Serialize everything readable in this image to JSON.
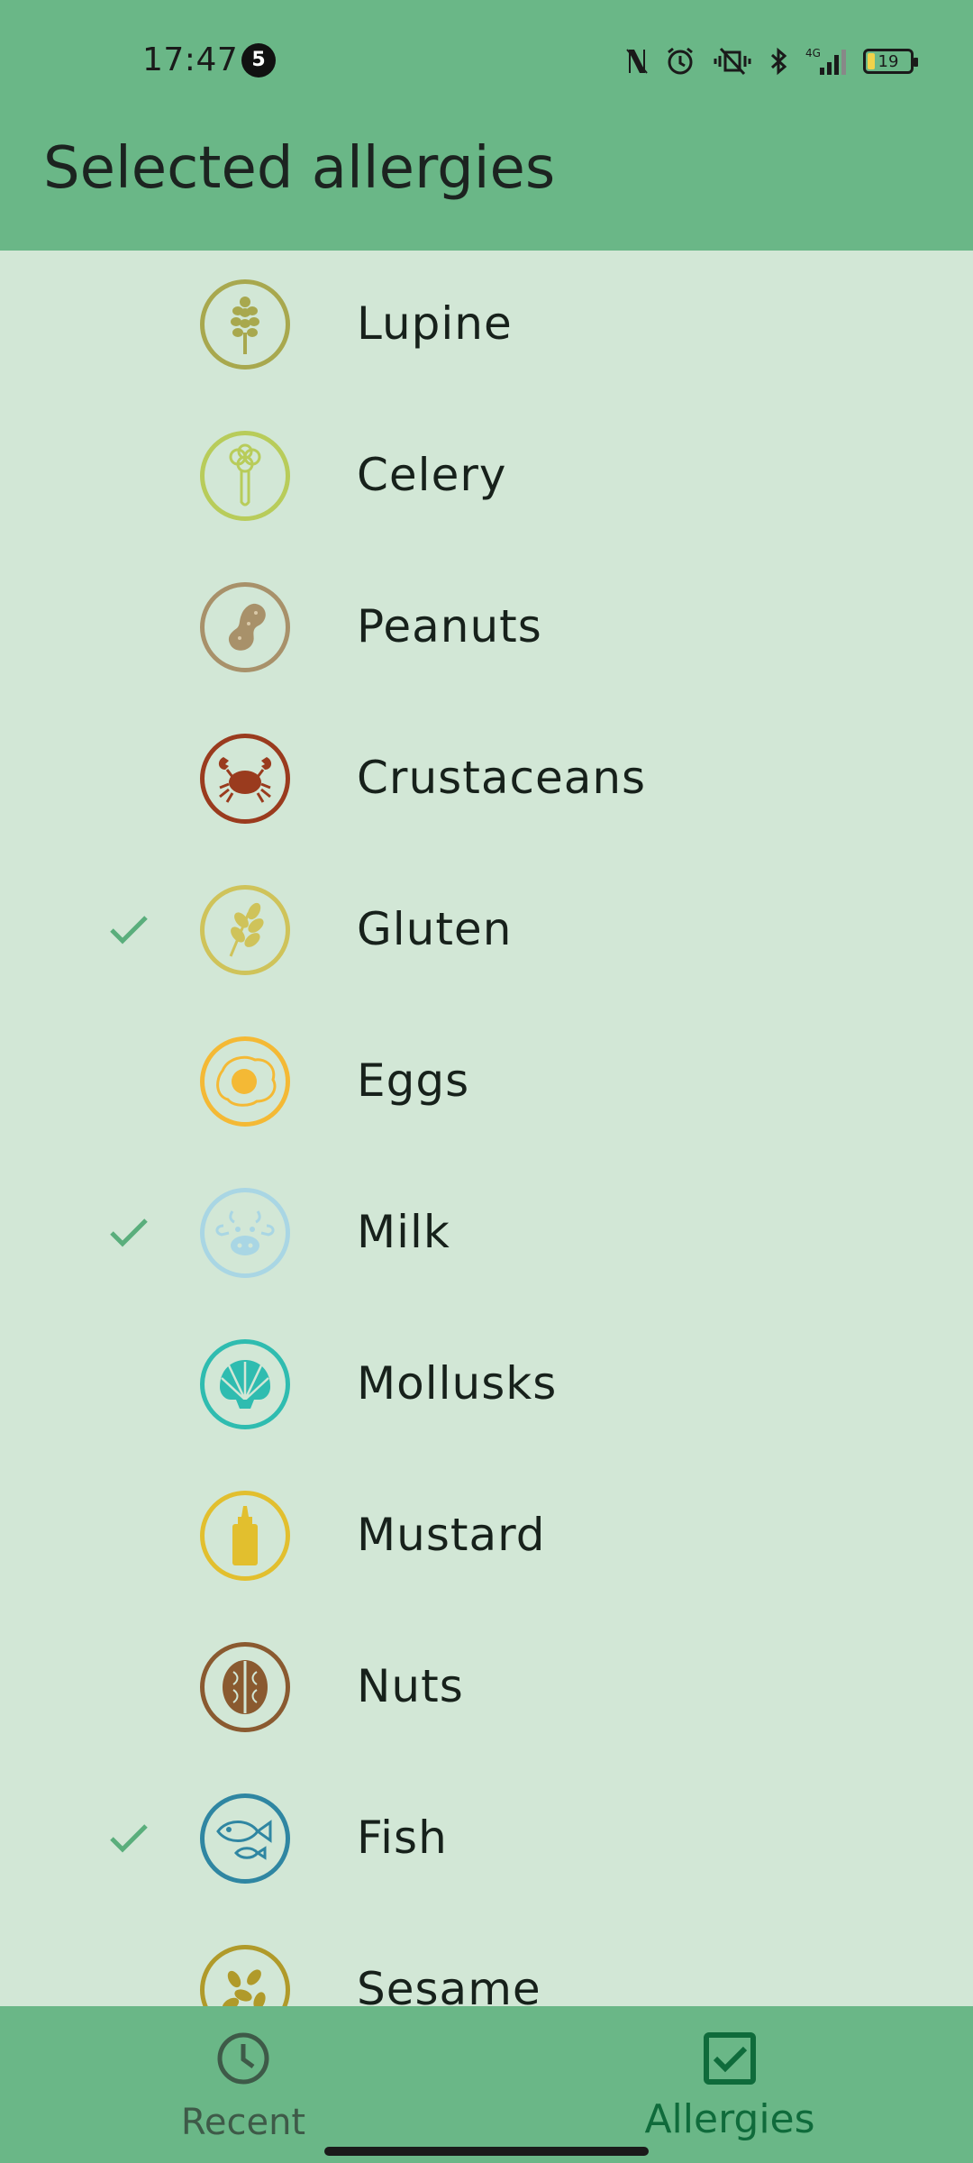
{
  "status_bar": {
    "time": "17:47",
    "notification_count": "5",
    "battery_level": "19",
    "network": "4G"
  },
  "app_bar": {
    "title": "Selected allergies"
  },
  "colors": {
    "primary": "#6ab787",
    "background": "#d2e7d6",
    "check": "#5aae7c",
    "nav_active": "#0f6b3b"
  },
  "allergies": [
    {
      "label": "Lupine",
      "icon": "lupine-icon",
      "selected": false,
      "color": "#a8a84e"
    },
    {
      "label": "Celery",
      "icon": "celery-icon",
      "selected": false,
      "color": "#b8cc5a"
    },
    {
      "label": "Peanuts",
      "icon": "peanut-icon",
      "selected": false,
      "color": "#a8916a"
    },
    {
      "label": "Crustaceans",
      "icon": "crab-icon",
      "selected": false,
      "color": "#9a3b1e"
    },
    {
      "label": "Gluten",
      "icon": "wheat-icon",
      "selected": true,
      "color": "#cfc35a"
    },
    {
      "label": "Eggs",
      "icon": "egg-icon",
      "selected": false,
      "color": "#f4b935"
    },
    {
      "label": "Milk",
      "icon": "cow-icon",
      "selected": true,
      "color": "#a9d6e4"
    },
    {
      "label": "Mollusks",
      "icon": "shell-icon",
      "selected": false,
      "color": "#2fbcb0"
    },
    {
      "label": "Mustard",
      "icon": "mustard-icon",
      "selected": false,
      "color": "#e2bf2e"
    },
    {
      "label": "Nuts",
      "icon": "walnut-icon",
      "selected": false,
      "color": "#8a5a30"
    },
    {
      "label": "Fish",
      "icon": "fish-icon",
      "selected": true,
      "color": "#2f86a2"
    },
    {
      "label": "Sesame",
      "icon": "sesame-icon",
      "selected": false,
      "color": "#b09a2a"
    }
  ],
  "bottom_nav": {
    "items": [
      {
        "label": "Recent",
        "icon": "clock-icon",
        "active": false
      },
      {
        "label": "Allergies",
        "icon": "checkbox-icon",
        "active": true
      }
    ]
  }
}
